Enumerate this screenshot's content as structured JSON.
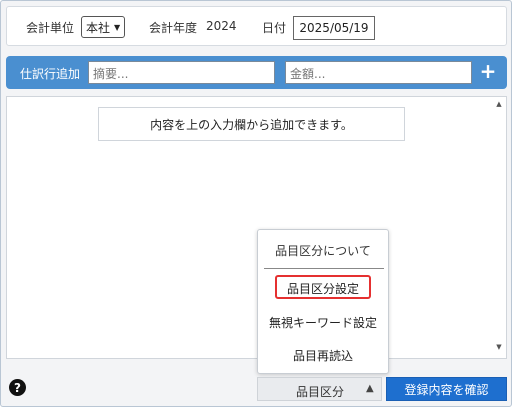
{
  "header": {
    "unit_label": "会計単位",
    "unit_value": "本社",
    "year_label": "会計年度",
    "year_value": "2024",
    "date_label": "日付",
    "date_value": "2025/05/19"
  },
  "add_bar": {
    "label": "仕訳行追加",
    "summary_placeholder": "摘要...",
    "amount_placeholder": "金額...",
    "plus": "+"
  },
  "list": {
    "empty_hint": "内容を上の入力欄から追加できます。"
  },
  "popup": {
    "title": "品目区分について",
    "items": [
      "品目区分設定",
      "無視キーワード設定",
      "品目再読込"
    ],
    "highlighted_index": 0
  },
  "footer": {
    "help": "?",
    "category_button": "品目区分",
    "confirm_button": "登録内容を確認"
  },
  "colors": {
    "bar_blue": "#4a8fd0",
    "confirm_blue": "#1e6fcf",
    "highlight_red": "#e53030"
  }
}
